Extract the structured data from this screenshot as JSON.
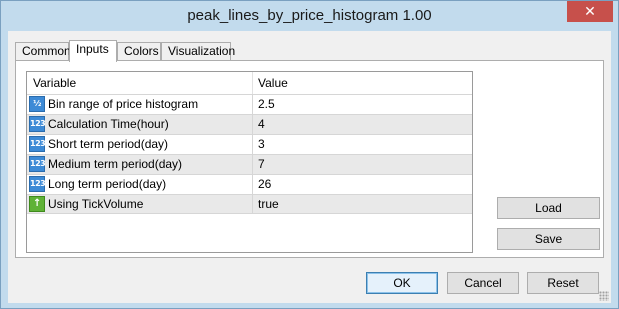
{
  "window": {
    "title": "peak_lines_by_price_histogram 1.00",
    "close_glyph": "✕"
  },
  "tabs": [
    {
      "label": "Common",
      "active": false
    },
    {
      "label": "Inputs",
      "active": true
    },
    {
      "label": "Colors",
      "active": false
    },
    {
      "label": "Visualization",
      "active": false
    }
  ],
  "grid": {
    "headers": {
      "variable": "Variable",
      "value": "Value"
    },
    "rows": [
      {
        "icon": "fraction-icon",
        "icon_text": "½",
        "name": "Bin range of price histogram",
        "value": "2.5"
      },
      {
        "icon": "integer-icon",
        "icon_text": "123",
        "name": "Calculation Time(hour)",
        "value": "4"
      },
      {
        "icon": "integer-icon",
        "icon_text": "123",
        "name": "Short term period(day)",
        "value": "3"
      },
      {
        "icon": "integer-icon",
        "icon_text": "123",
        "name": "Medium term period(day)",
        "value": "7"
      },
      {
        "icon": "integer-icon",
        "icon_text": "123",
        "name": "Long term period(day)",
        "value": "26"
      },
      {
        "icon": "boolean-icon",
        "icon_text": "↑",
        "name": "Using TickVolume",
        "value": "true"
      }
    ]
  },
  "buttons": {
    "load": "Load",
    "save": "Save",
    "ok": "OK",
    "cancel": "Cancel",
    "reset": "Reset"
  },
  "colors": {
    "title_bar": "#c2dbed",
    "close_button": "#c7504b",
    "alt_row": "#e9e9e9",
    "numeric_icon": "#3d8ad6",
    "bool_icon": "#5fb236"
  }
}
